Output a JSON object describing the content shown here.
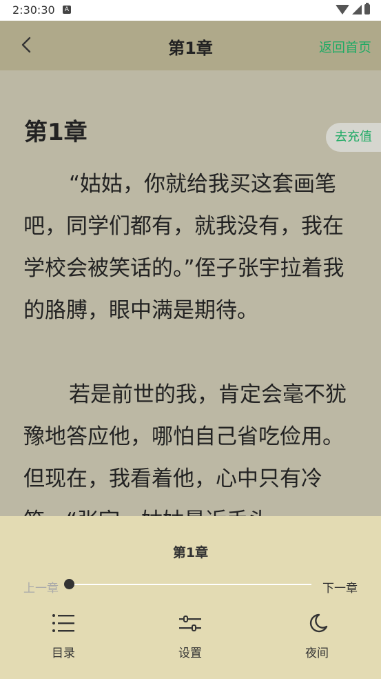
{
  "status_bar": {
    "time": "2:30:30",
    "notification_icon": "A"
  },
  "header": {
    "title": "第1章",
    "home_link": "返回首页"
  },
  "content": {
    "chapter_heading": "第1章",
    "recharge_label": "去充值",
    "paragraphs": [
      "“姑姑，你就给我买这套画笔吧，同学们都有，就我没有，我在学校会被笑话的。”侄子张宇拉着我的胳膊，眼中满是期待。",
      "若是前世的我，肯定会毫不犹豫地答应他，哪怕自己省吃俭用。但现在，我看着他，心中只有冷笑。“张宇，姑姑最近手头"
    ]
  },
  "panel": {
    "chapter_title": "第1章",
    "prev_chapter": "上一章",
    "next_chapter": "下一章",
    "progress_fraction": 0,
    "tabs": [
      {
        "label": "目录",
        "icon": "list-icon"
      },
      {
        "label": "设置",
        "icon": "sliders-icon"
      },
      {
        "label": "夜间",
        "icon": "moon-icon"
      }
    ]
  },
  "colors": {
    "accent": "#1eaa64",
    "header_bg": "#afa98a",
    "content_bg": "#bcb8a4",
    "panel_bg": "#e3dbb3"
  }
}
